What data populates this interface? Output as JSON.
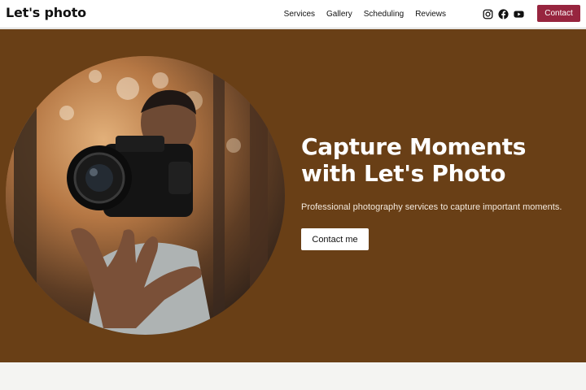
{
  "header": {
    "logo": "Let's photo",
    "nav": [
      {
        "label": "Services"
      },
      {
        "label": "Gallery"
      },
      {
        "label": "Scheduling"
      },
      {
        "label": "Reviews"
      }
    ],
    "social_icons": [
      "instagram-icon",
      "facebook-icon",
      "youtube-icon"
    ],
    "contact_label": "Contact",
    "accent_color": "#97253f"
  },
  "hero": {
    "title_line_1": "Capture Moments",
    "title_line_2": "with Let's Photo",
    "subtitle": "Professional photography services to capture important moments.",
    "cta_label": "Contact me",
    "background_color": "#693f16"
  }
}
